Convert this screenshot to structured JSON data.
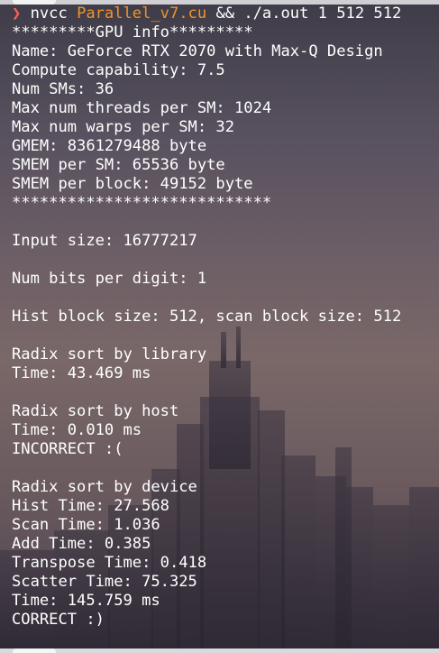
{
  "colors": {
    "text": "#ffffff",
    "prompt_arrow": "#ff5f56",
    "filename": "#f0922e"
  },
  "icons": {
    "prompt": "chevron-right-icon"
  },
  "terminal": {
    "prompt_symbol": "❯",
    "command": {
      "program": "nvcc",
      "file": "Parallel_v7.cu",
      "operator": "&&",
      "run": "./a.out 1 512 512"
    },
    "output_lines": [
      "*********GPU info*********",
      "Name: GeForce RTX 2070 with Max-Q Design",
      "Compute capability: 7.5",
      "Num SMs: 36",
      "Max num threads per SM: 1024",
      "Max num warps per SM: 32",
      "GMEM: 8361279488 byte",
      "SMEM per SM: 65536 byte",
      "SMEM per block: 49152 byte",
      "****************************",
      "",
      "Input size: 16777217",
      "",
      "Num bits per digit: 1",
      "",
      "Hist block size: 512, scan block size: 512",
      "",
      "Radix sort by library",
      "Time: 43.469 ms",
      "",
      "Radix sort by host",
      "Time: 0.010 ms",
      "INCORRECT :(",
      "",
      "Radix sort by device",
      "Hist Time: 27.568",
      "Scan Time: 1.036",
      "Add Time: 0.385",
      "Transpose Time: 0.418",
      "Scatter Time: 75.325",
      "Time: 145.759 ms",
      "CORRECT :)"
    ]
  }
}
